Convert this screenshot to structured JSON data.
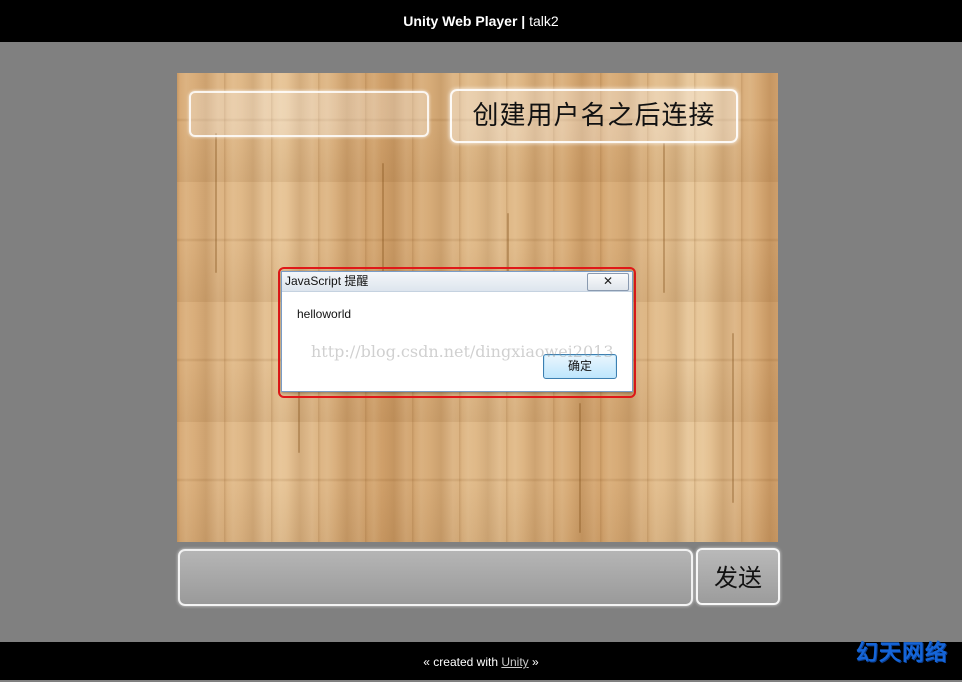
{
  "header": {
    "title_bold": "Unity Web Player |",
    "title_rest": " talk2"
  },
  "game": {
    "username_input_value": "",
    "connect_button_label": "创建用户名之后连接",
    "chat_input_value": "",
    "send_button_label": "发送"
  },
  "alert_dialog": {
    "title": "JavaScript 提醒",
    "close_glyph": "✕",
    "message": "helloworld",
    "ok_label": "确定"
  },
  "image_watermark": "http://blog.csdn.net/dingxiaowei2013",
  "footer": {
    "prefix": "« created with ",
    "link_text": "Unity",
    "suffix": " »"
  },
  "corner_logo": "幻天网络",
  "colors": {
    "annotation_outline": "#e01818",
    "logo": "#1565d8"
  }
}
